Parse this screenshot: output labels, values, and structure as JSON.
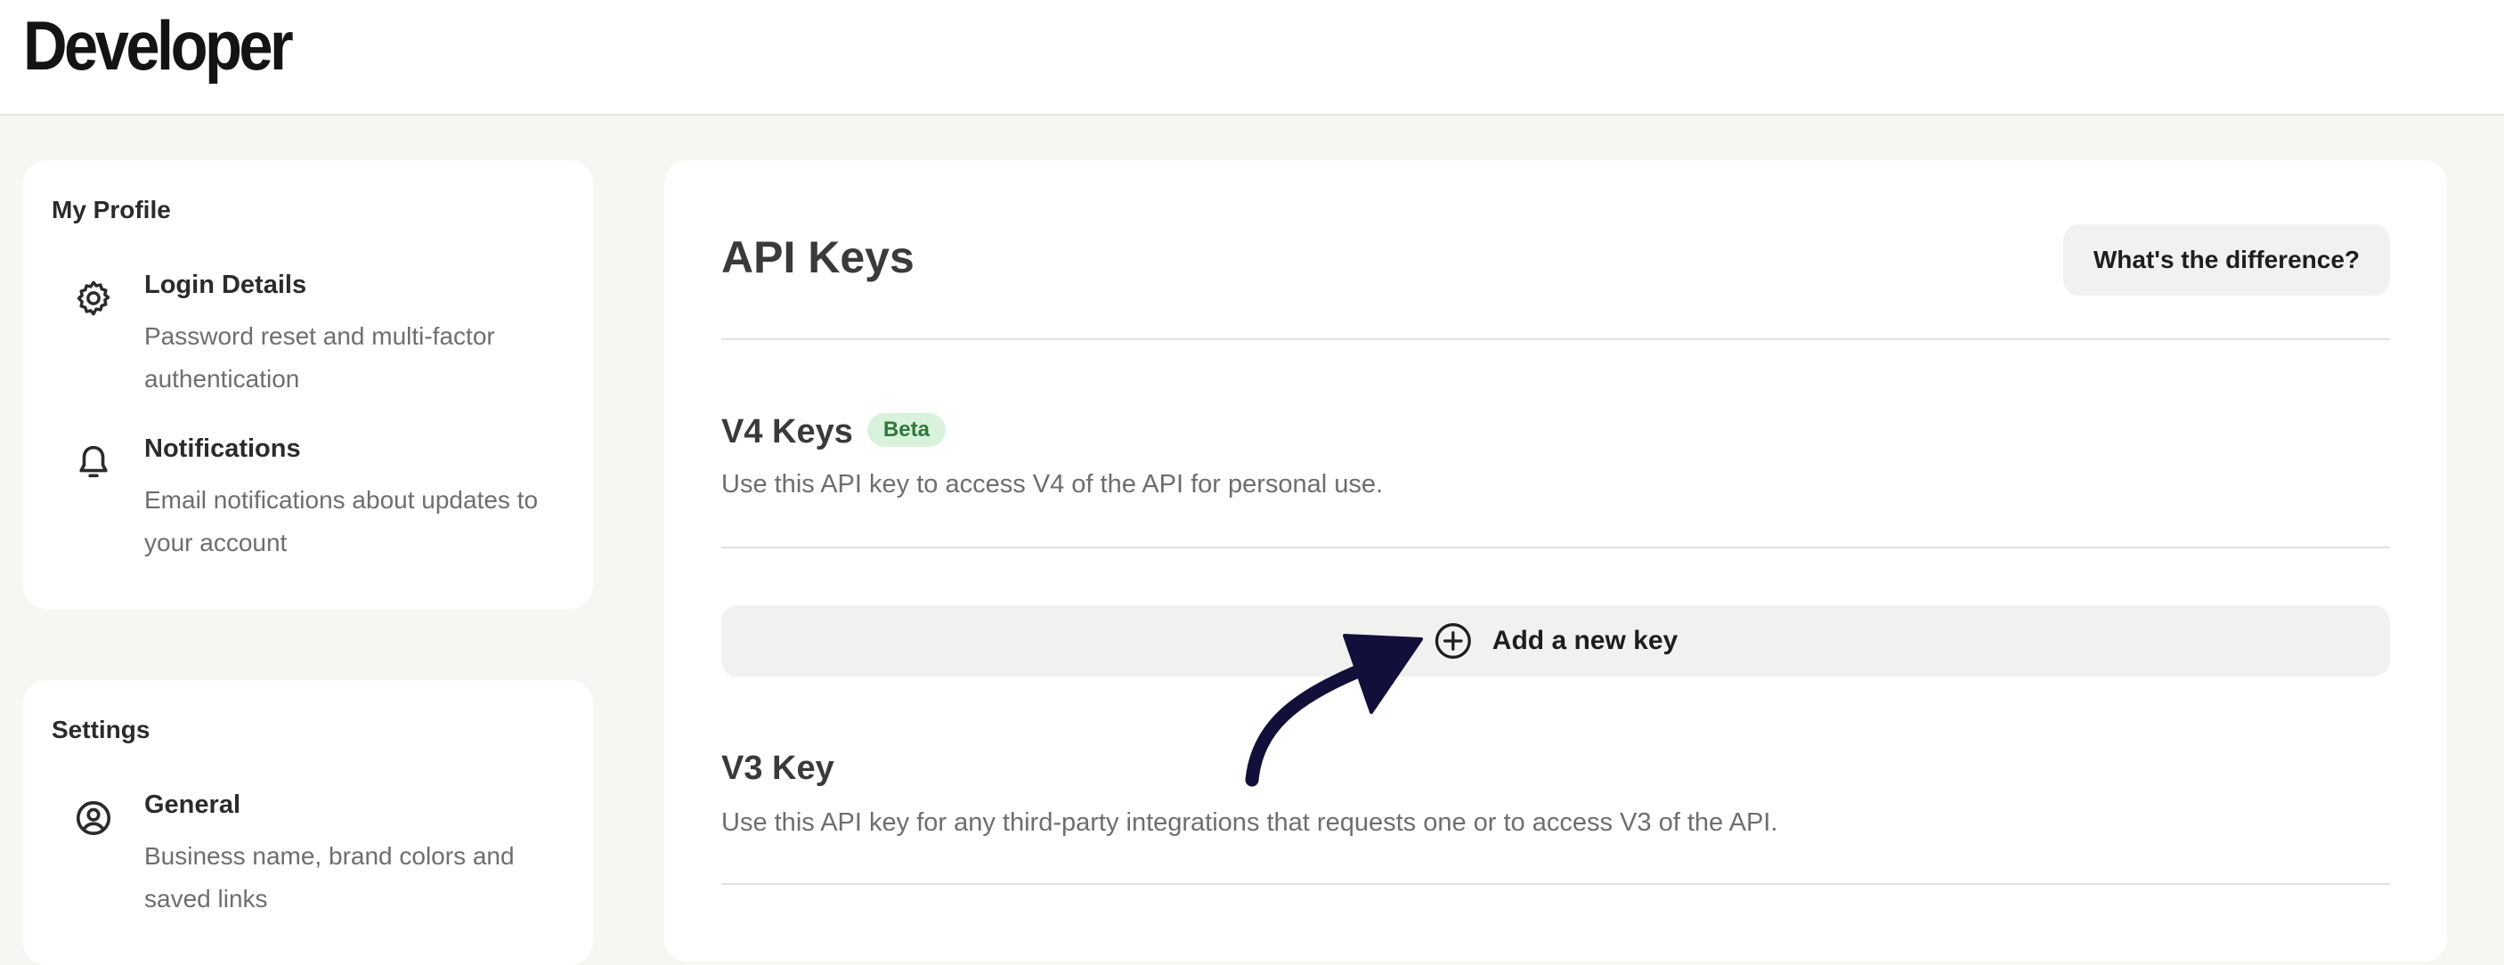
{
  "header": {
    "brand": "Developer"
  },
  "sidebar": {
    "profile": {
      "title": "My Profile",
      "items": [
        {
          "label": "Login Details",
          "desc": "Password reset and multi-factor authentication",
          "icon": "gear-icon"
        },
        {
          "label": "Notifications",
          "desc": "Email notifications about updates to your account",
          "icon": "bell-icon"
        }
      ]
    },
    "settings": {
      "title": "Settings",
      "items": [
        {
          "label": "General",
          "desc": "Business name, brand colors and saved links",
          "icon": "user-circle-icon"
        }
      ]
    }
  },
  "main": {
    "title": "API Keys",
    "difference_button": "What's the difference?",
    "v4": {
      "title": "V4 Keys",
      "badge": "Beta",
      "desc": "Use this API key to access V4 of the API for personal use."
    },
    "add_key_button": "Add a new key",
    "v3": {
      "title": "V3 Key",
      "desc": "Use this API key for any third-party integrations that requests one or to access V3 of the API."
    }
  },
  "colors": {
    "background": "#f7f6f2",
    "card": "#ffffff",
    "button_bg": "#f1f1f0",
    "badge_bg": "#d9f2dc",
    "badge_text": "#2e7a3b",
    "arrow": "#12103a"
  }
}
